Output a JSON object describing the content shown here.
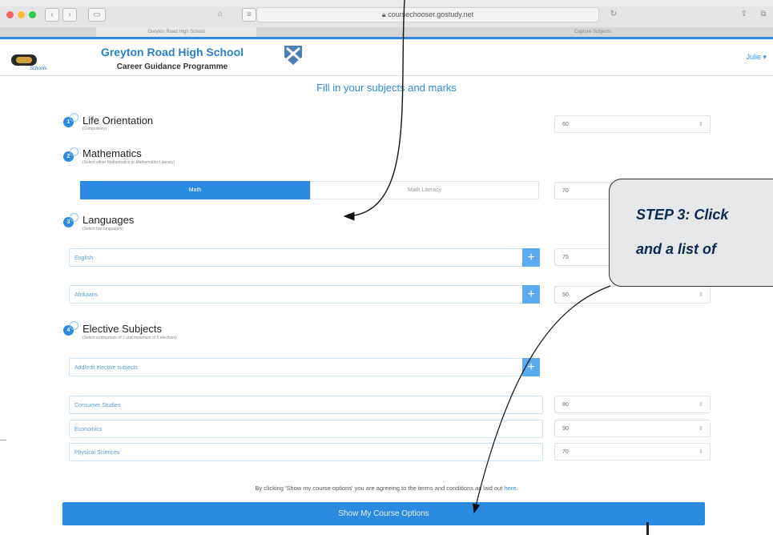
{
  "browser": {
    "url": "coursechooser.gostudy.net",
    "tabs": [
      "Greyton Road High School",
      "Capture Subjects"
    ],
    "lock_icon": "lock-icon"
  },
  "header": {
    "logo_text": "Schools",
    "school_name": "Greyton Road High School",
    "programme": "Career Guidance Programme",
    "user": "Julie ▾"
  },
  "page_title": "Fill in your subjects and marks",
  "sections": {
    "life_orientation": {
      "number": "1",
      "title": "Life Orientation",
      "subtitle": "(Compulsory)",
      "mark": "60"
    },
    "mathematics": {
      "number": "2",
      "title": "Mathematics",
      "subtitle": "(Select either Mathematics or Mathematics Literacy)",
      "option_selected": "Math",
      "option_other": "Math Literacy",
      "mark": "70"
    },
    "languages": {
      "number": "3",
      "title": "Languages",
      "subtitle": "(Select two languages)",
      "items": [
        {
          "name": "English",
          "mark": "75"
        },
        {
          "name": "Afrikaans",
          "mark": "50"
        }
      ]
    },
    "electives": {
      "number": "4",
      "title": "Elective Subjects",
      "subtitle": "(Select a minumum of 3 and maximum of 5 electives)",
      "add_placeholder": "Add/edit elective subjects",
      "items": [
        {
          "name": "Consumer Studies",
          "mark": "80"
        },
        {
          "name": "Economics",
          "mark": "90"
        },
        {
          "name": "Physical Sciences",
          "mark": "70"
        }
      ]
    }
  },
  "agreement": {
    "text": "By clicking 'Show my course options' you are agreeing to the terms and conditions as laid out",
    "link": "here."
  },
  "submit_label": "Show My Course Options",
  "callout": {
    "line1": "STEP 3:  Click",
    "line2": "and a list of"
  },
  "colors": {
    "accent": "#2b8be0",
    "callout_bg": "#e6e7e9",
    "callout_text": "#0b2a4e"
  }
}
